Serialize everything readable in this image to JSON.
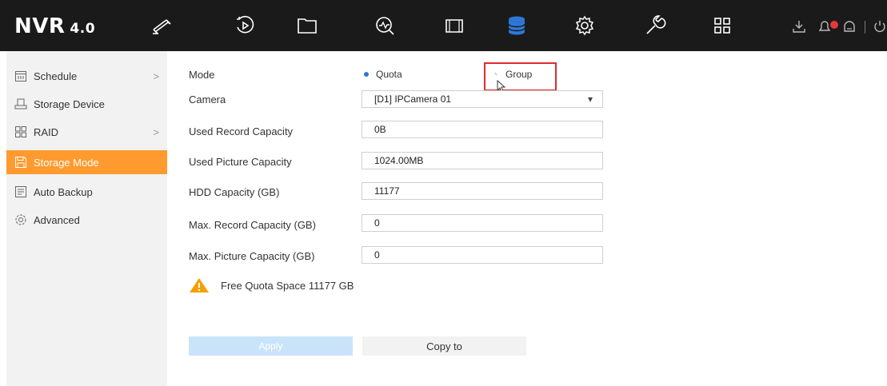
{
  "header": {
    "logo": "NVR",
    "version": "4.0",
    "icons": [
      "live-view-icon",
      "playback-icon",
      "file-management-icon",
      "smart-analysis-icon",
      "configuration-icon",
      "storage-icon",
      "settings-icon",
      "maintenance-icon",
      "menu-grid-icon",
      "download-icon",
      "alarm-icon",
      "user-icon",
      "power-icon"
    ],
    "active_icon": "storage-icon",
    "accent_color": "#2f77d6"
  },
  "sidebar": {
    "items": [
      {
        "label": "Schedule",
        "icon": "calendar-icon",
        "has_arrow": true
      },
      {
        "label": "Storage Device",
        "icon": "storage-device-icon",
        "has_arrow": false
      },
      {
        "label": "RAID",
        "icon": "raid-icon",
        "has_arrow": true
      },
      {
        "label": "Storage Mode",
        "icon": "save-icon",
        "has_arrow": false,
        "active": true
      },
      {
        "label": "Auto Backup",
        "icon": "backup-icon",
        "has_arrow": false
      },
      {
        "label": "Advanced",
        "icon": "gear-icon",
        "has_arrow": false
      }
    ],
    "arrow": ">",
    "active_color": "#ff9a2e"
  },
  "form": {
    "mode_label": "Mode",
    "mode_options": [
      "Quota",
      "Group"
    ],
    "mode_selected": "Quota",
    "camera_label": "Camera",
    "camera_value": "[D1] IPCamera 01",
    "select_arrow": "▾",
    "used_record_label": "Used Record Capacity",
    "used_record_value": "0B",
    "used_picture_label": "Used Picture Capacity",
    "used_picture_value": "1024.00MB",
    "hdd_label": "HDD Capacity (GB)",
    "hdd_value": "11177",
    "max_record_label": "Max. Record Capacity (GB)",
    "max_record_value": "0",
    "max_picture_label": "Max. Picture Capacity (GB)",
    "max_picture_value": "0"
  },
  "warning": {
    "text": "Free Quota Space 11177 GB",
    "icon": "warning-icon",
    "color": "#f5a000"
  },
  "buttons": {
    "apply": "Apply",
    "copy_to": "Copy to"
  },
  "highlight_color": "#e02b2b"
}
